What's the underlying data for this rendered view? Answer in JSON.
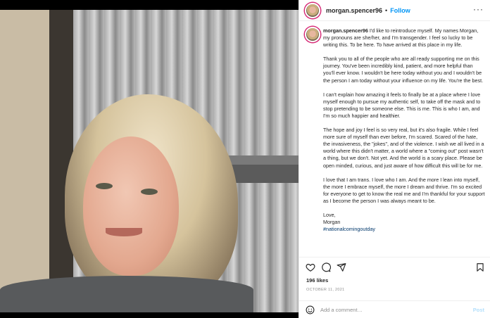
{
  "post": {
    "username": "morgan.spencer96",
    "separator": "•",
    "follow_label": "Follow",
    "more_icon": "more-horizontal-icon",
    "caption_paragraphs": [
      "I'd like to reintroduce myself. My names Morgan, my pronouns are she/her, and I'm transgender. I feel so lucky to be writing this. To be here. To have arrived at this place in my life.",
      "Thank you to all of the people who are all ready supporting me on this journey. You've been incredibly kind, patient, and more helpful than you'll ever know. I wouldn't be here today without you and I wouldn't be the person I am today without your influence on my life. You're the best.",
      "I can't explain how amazing it feels to finally be at a place where I love myself enough to pursue my authentic self, to take off the mask and to stop pretending to be someone else. This is me. This is who I am, and I'm so much happier and healthier.",
      "The hope and joy I feel is so very real, but it's also fragile. While I feel more sure of myself than ever before, I'm scared. Scared of the hate, the invasiveness, the \"jokes\", and of the violence. I wish we all lived in a world where this didn't matter, a world where a \"coming out\" post wasn't a thing, but we don't. Not yet. And the world is a scary place. Please be open minded, curious, and just aware of how difficult this will be for me.",
      "I love that I am trans. I love who I am. And the more I lean into myself, the more I embrace myself, the more I dream and thrive. I'm so excited for everyone to get to know the real me and I'm thankful for your support as I become the person I was always meant to be."
    ],
    "signoff_line1": "Love,",
    "signoff_line2": "Morgan",
    "hashtag": "#nationalcomingoutday",
    "likes": "196 likes",
    "date": "OCTOBER 11, 2021",
    "comment_placeholder": "Add a comment…",
    "post_label": "Post"
  },
  "icons": {
    "like": "heart-icon",
    "comment": "comment-icon",
    "share": "send-icon",
    "save": "bookmark-icon",
    "emoji": "smiley-icon"
  },
  "colors": {
    "link_blue": "#0095f6",
    "hashtag_blue": "#00376b",
    "muted": "#8e8e8e",
    "post_disabled": "#b2dffc"
  }
}
